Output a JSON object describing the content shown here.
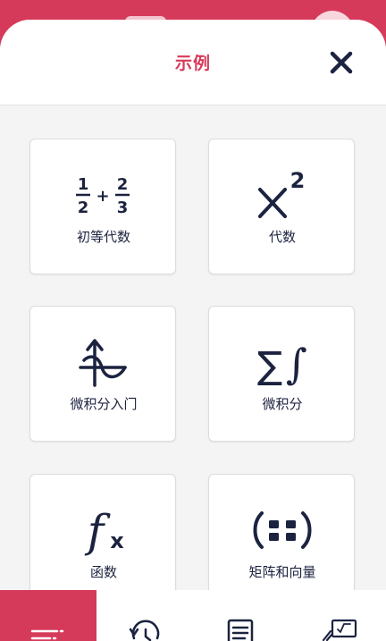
{
  "sheet": {
    "title": "示例"
  },
  "examples": [
    {
      "label": "初等代数",
      "icon": "fraction-addition-icon"
    },
    {
      "label": "代数",
      "icon": "x-squared-icon"
    },
    {
      "label": "微积分入门",
      "icon": "function-graph-icon"
    },
    {
      "label": "微积分",
      "icon": "sum-integral-icon"
    },
    {
      "label": "函数",
      "icon": "fx-icon"
    },
    {
      "label": "矩阵和向量",
      "icon": "matrix-icon"
    }
  ],
  "glyphs": {
    "frac_a_num": "1",
    "frac_a_den": "2",
    "plus": "+",
    "frac_b_num": "2",
    "frac_b_den": "3",
    "exponent": "2",
    "sigma": "∑",
    "integral": "∫",
    "fx_f": "f",
    "fx_x": "x"
  },
  "tabs": [
    {
      "icon": "examples-menu-icon",
      "active": true
    },
    {
      "icon": "history-icon",
      "active": false
    },
    {
      "icon": "notes-icon",
      "active": false
    },
    {
      "icon": "scratchpad-icon",
      "active": false
    }
  ],
  "colors": {
    "accent": "#d63a5a",
    "ink": "#1c2340",
    "card": "#ffffff",
    "sheet": "#f4f4f5"
  }
}
